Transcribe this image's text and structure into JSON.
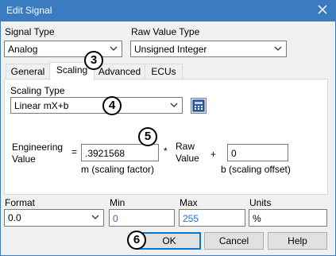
{
  "window": {
    "title": "Edit Signal",
    "close_icon": "close-icon"
  },
  "signal_type": {
    "label": "Signal Type",
    "value": "Analog"
  },
  "raw_value_type": {
    "label": "Raw Value Type",
    "value": "Unsigned Integer"
  },
  "tabs": [
    {
      "label": "General",
      "active": false
    },
    {
      "label": "Scaling",
      "active": true
    },
    {
      "label": "Advanced",
      "active": false
    },
    {
      "label": "ECUs",
      "active": false
    }
  ],
  "scaling": {
    "type_label": "Scaling Type",
    "type_value": "Linear mX+b",
    "calc_icon": "calculator-icon",
    "eq_left_line1": "Engineering",
    "eq_left_line2": "Value",
    "equals": "=",
    "factor_value": ".3921568",
    "times": "*",
    "raw_line1": "Raw",
    "raw_line2": "Value",
    "plus": "+",
    "offset_value": "0",
    "factor_caption": "m (scaling factor)",
    "offset_caption": "b (scaling offset)"
  },
  "format": {
    "label": "Format",
    "value": "0.0"
  },
  "min": {
    "label": "Min",
    "value": "0"
  },
  "max": {
    "label": "Max",
    "value": "255"
  },
  "units": {
    "label": "Units",
    "value": "%"
  },
  "buttons": {
    "ok": "OK",
    "cancel": "Cancel",
    "help": "Help"
  },
  "annotations": {
    "badge3": "3",
    "badge4": "4",
    "badge5": "5",
    "badge6": "6"
  },
  "colors": {
    "titlebar": "#3b7bbf",
    "value_blue": "#1f6fd1",
    "focus": "#0078d7"
  }
}
